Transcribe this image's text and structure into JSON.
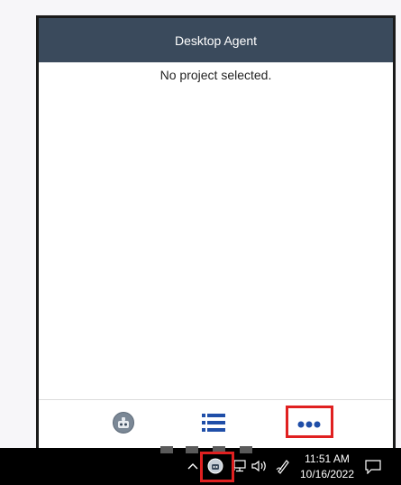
{
  "app": {
    "title": "Desktop Agent",
    "empty_message": "No project selected."
  },
  "footer": {
    "nav": [
      {
        "name": "agent",
        "icon": "robot-icon"
      },
      {
        "name": "list",
        "icon": "list-icon"
      },
      {
        "name": "more",
        "icon": "more-dots-icon"
      }
    ]
  },
  "taskbar": {
    "time": "11:51 AM",
    "date": "10/16/2022",
    "tray_icons": [
      "chevron-up-icon",
      "agent-tray-icon",
      "network-icon",
      "volume-icon",
      "pen-icon",
      "notification-icon"
    ]
  },
  "colors": {
    "header_bg": "#3a4a5c",
    "accent_blue": "#1f4ea8",
    "highlight_red": "#e02020",
    "taskbar_bg": "#000000"
  }
}
